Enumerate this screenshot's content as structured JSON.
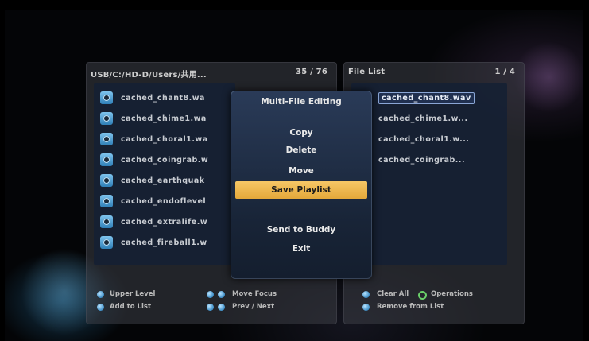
{
  "left_panel": {
    "path": "USB/C:/HD-D/Users/共用...",
    "count": "35 / 76",
    "files": [
      "cached_chant8.wa",
      "cached_chime1.wa",
      "cached_choral1.wa",
      "cached_coingrab.w",
      "cached_earthquak",
      "cached_endoflevel",
      "cached_extralife.w",
      "cached_fireball1.w"
    ]
  },
  "right_panel": {
    "title": "File List",
    "count": "1 / 4",
    "files": [
      "cached_chant8.wav",
      "cached_chime1.w...",
      "cached_choral1.w...",
      "cached_coingrab..."
    ]
  },
  "popup": {
    "title": "Multi-File Editing",
    "items": [
      "Copy",
      "Delete",
      "Move",
      "Save Playlist",
      "Send to Buddy",
      "Exit"
    ],
    "selected": "Save Playlist"
  },
  "hints": {
    "upper_level": "Upper Level",
    "add_to_list": "Add to List",
    "move_focus": "Move Focus",
    "prev_next": "Prev / Next",
    "clear_all": "Clear All",
    "operations": "Operations",
    "remove_from_list": "Remove from List"
  },
  "colors": {
    "selection": "#e4a83a",
    "list_bg": "#14203a",
    "key_blue": "#3f8fc8",
    "key_green": "#6ad06a"
  }
}
